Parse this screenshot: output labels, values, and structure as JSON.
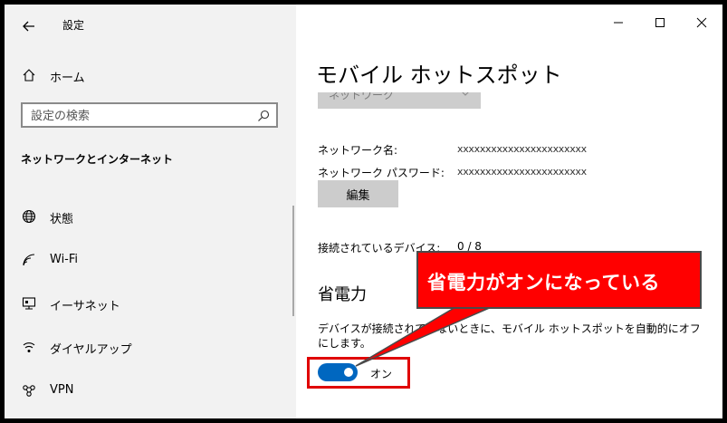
{
  "window": {
    "app_title": "設定",
    "controls": {
      "minimize": "minimize-icon",
      "maximize": "maximize-icon",
      "close": "close-icon"
    }
  },
  "sidebar": {
    "home_label": "ホーム",
    "search": {
      "placeholder": "設定の検索"
    },
    "section_title": "ネットワークとインターネット",
    "items": [
      {
        "label": "状態",
        "icon": "globe-icon"
      },
      {
        "label": "Wi-Fi",
        "icon": "wifi-icon"
      },
      {
        "label": "イーサネット",
        "icon": "ethernet-icon"
      },
      {
        "label": "ダイヤルアップ",
        "icon": "dialup-icon"
      },
      {
        "label": "VPN",
        "icon": "vpn-icon"
      }
    ]
  },
  "main": {
    "page_title": "モバイル ホットスポット",
    "network_dropdown": "ネットワーク",
    "network_name_label": "ネットワーク名:",
    "network_name_value": "xxxxxxxxxxxxxxxxxxxxxxx",
    "network_password_label": "ネットワーク パスワード:",
    "network_password_value": "xxxxxxxxxxxxxxxxxxxxxxx",
    "edit_button": "編集",
    "connected_label": "接続されているデバイス:",
    "connected_value": "0 / 8",
    "power_title": "省電力",
    "power_desc": "デバイスが接続されていないときに、モバイル ホットスポットを自動的にオフにします。",
    "toggle_label": "オン",
    "toggle_state": true
  },
  "annotation": {
    "callout_text": "省電力がオンになっている",
    "color": "#ff0000"
  },
  "colors": {
    "accent": "#0067c0",
    "sidebar_bg": "#f2f2f2",
    "annotation_red": "#ff0000"
  }
}
